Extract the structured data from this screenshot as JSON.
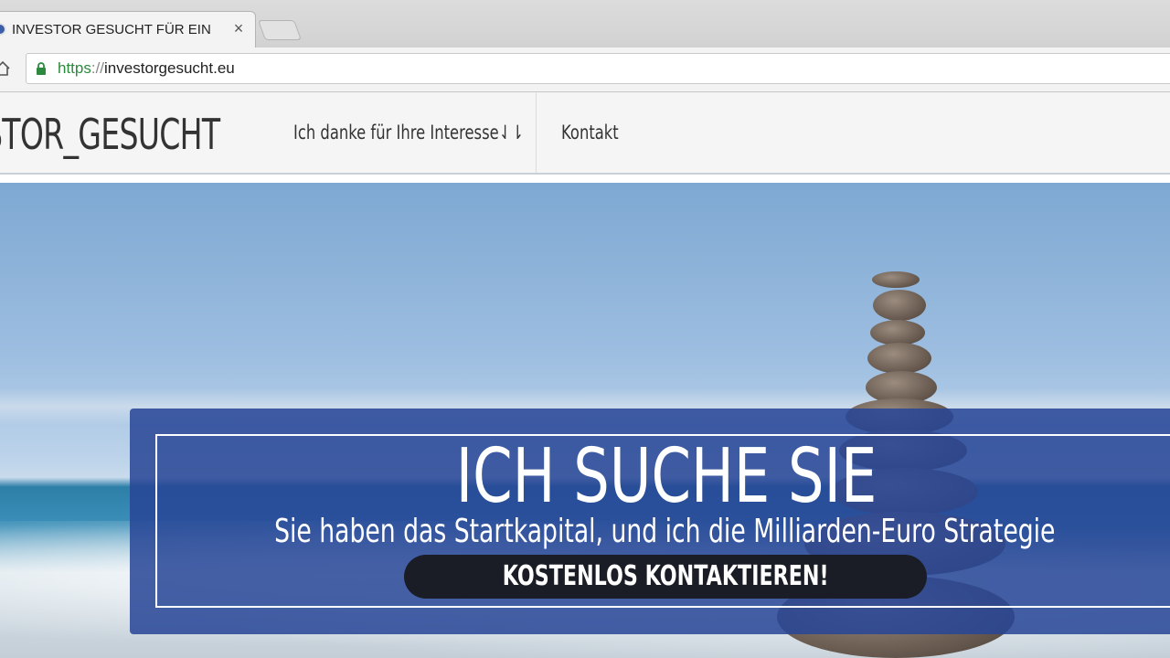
{
  "browser": {
    "tab_title": "INVESTOR GESUCHT FÜR EIN",
    "tab_close": "×",
    "url_scheme": "https",
    "url_separator": "://",
    "url_host": "investorgesucht.eu"
  },
  "site": {
    "logo": "STOR_GESUCHT",
    "nav": [
      {
        "label": "Ich danke für Ihre Interesse⇃⇂"
      },
      {
        "label": "Kontakt"
      }
    ]
  },
  "hero": {
    "title": "ICH SUCHE SIE",
    "subtitle": "Sie haben das Startkapital, und ich die Milliarden-Euro Strategie",
    "cta": "KOSTENLOS KONTAKTIEREN!"
  }
}
